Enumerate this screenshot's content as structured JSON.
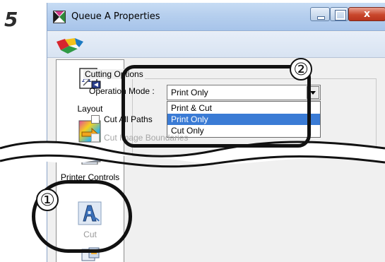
{
  "step": "5",
  "window": {
    "title": "Queue A Properties",
    "close_glyph": "x"
  },
  "sidebar": {
    "items": [
      {
        "label": "Layout",
        "icon": "layout-icon"
      },
      {
        "label": "",
        "icon": "color-management-icon"
      },
      {
        "label": "Printer Controls",
        "icon": "printer-controls-icon"
      },
      {
        "label": "Cut",
        "icon": "cut-icon"
      },
      {
        "label": "",
        "icon": "folder-icon"
      }
    ]
  },
  "cutting_options": {
    "group_title": "Cutting Options",
    "operation_mode_label": "Operation Mode :",
    "operation_mode_value": "Print Only",
    "options": [
      "Print & Cut",
      "Print Only",
      "Cut Only"
    ],
    "selected_index": 1,
    "cut_all_paths_label": "Cut All Paths",
    "cut_image_boundaries_label": "Cut Image Boundaries"
  },
  "callouts": {
    "one": "①",
    "two": "②"
  },
  "colors": {
    "titlebar": "#b6cfee",
    "selection": "#3a7bd5",
    "close_button": "#c9472c"
  }
}
